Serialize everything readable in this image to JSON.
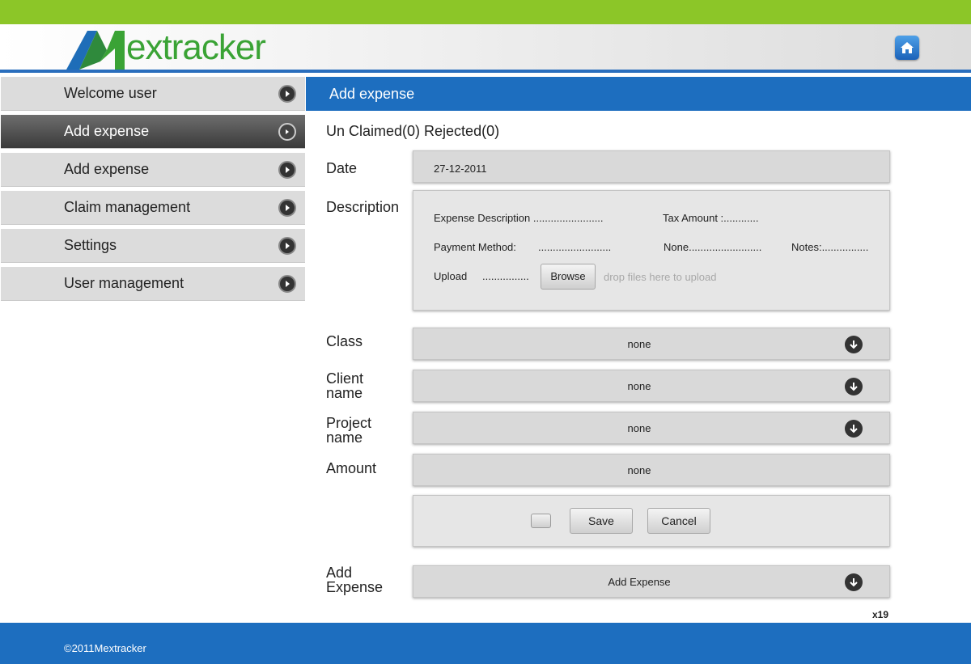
{
  "brand": {
    "logo_text": "extracker",
    "logo_letter": "M"
  },
  "header": {
    "home_icon": "home-icon"
  },
  "sidebar": {
    "items": [
      {
        "label": "Welcome user"
      },
      {
        "label": "Add expense",
        "active": true
      },
      {
        "label": "Add expense"
      },
      {
        "label": "Claim management"
      },
      {
        "label": "Settings"
      },
      {
        "label": "User management"
      }
    ]
  },
  "main": {
    "title": "Add expense",
    "counts": "Un Claimed(0) Rejected(0)",
    "labels": {
      "date": "Date",
      "description": "Description",
      "class": "Class",
      "client_name_1": "Client",
      "client_name_2": "name",
      "project_name_1": "Project",
      "project_name_2": "name",
      "amount": "Amount",
      "add_expense_1": "Add",
      "add_expense_2": "Expense"
    },
    "date_value": "27-12-2011",
    "description": {
      "expense_description": "Expense Description ........................",
      "tax_amount": "Tax Amount :............",
      "payment_method": "Payment Method:",
      "payment_dots": ".........................",
      "none_dots": "None.........................",
      "notes": "Notes:................",
      "upload": "Upload",
      "upload_dots": "................",
      "browse_label": "Browse",
      "drop_hint": "drop files here to upload"
    },
    "class_value": "none",
    "client_value": "none",
    "project_value": "none",
    "amount_value": "none",
    "save_label": "Save",
    "cancel_label": "Cancel",
    "add_expense_value": "Add Expense",
    "counter": "x19"
  },
  "footer": {
    "copyright": "©2011Mextracker"
  },
  "colors": {
    "top_bar": "#8cc628",
    "accent_blue": "#1d6ebf",
    "sidebar_bg": "#dcdcdc",
    "sidebar_active": "#4a4a4a"
  }
}
